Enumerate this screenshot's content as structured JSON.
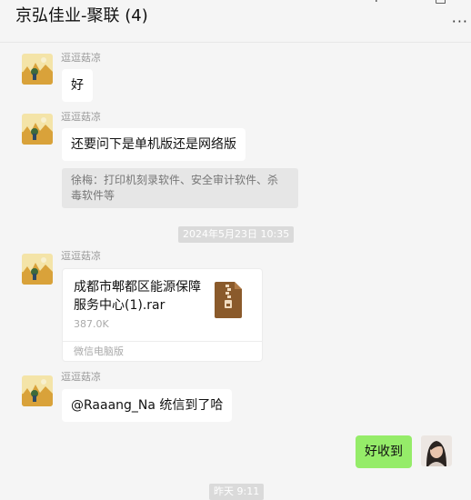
{
  "header": {
    "title": "京弘佳业-聚联 (4)",
    "minimize_icon": "+",
    "close_icon": "□",
    "more_icon": "···"
  },
  "messages": [
    {
      "sender": "逗逗菇凉",
      "text": "好"
    },
    {
      "sender": "逗逗菇凉",
      "text": "还要问下是单机版还是网络版",
      "quote": {
        "author": "徐梅",
        "sep": "：",
        "text": "打印机刻录软件、安全审计软件、杀毒软件等"
      }
    },
    {
      "time": "2024年5月23日 10:35"
    },
    {
      "sender": "逗逗菇凉",
      "file": {
        "name": "成都市郫都区能源保障服务中心(1).rar",
        "size": "387.0K",
        "source": "微信电脑版",
        "icon": "zip-archive-icon"
      }
    },
    {
      "sender": "逗逗菇凉",
      "text": "@Raaang_Na  统信到了哈"
    },
    {
      "mine": true,
      "text": "好收到"
    },
    {
      "time": "昨天 9:11"
    }
  ],
  "colors": {
    "background": "#f5f5f5",
    "bubble_other": "#ffffff",
    "bubble_mine": "#95ec69",
    "quote_bg": "#e6e6e6",
    "time_bg": "#dadada",
    "zip_icon": "#8a5a2b"
  }
}
